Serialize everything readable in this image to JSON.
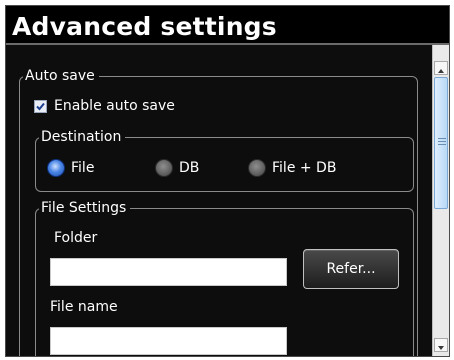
{
  "window": {
    "title": "Advanced settings"
  },
  "auto_save": {
    "legend": "Auto save",
    "enable_label": "Enable auto save",
    "enable_checked": true
  },
  "destination": {
    "legend": "Destination",
    "options": [
      "File",
      "DB",
      "File + DB"
    ],
    "selected": "File"
  },
  "file_settings": {
    "legend": "File Settings",
    "folder_label": "Folder",
    "folder_value": "",
    "refer_button": "Refer...",
    "file_name_label": "File name",
    "file_name_value": ""
  },
  "icons": {
    "scroll_up": "up-arrow-icon",
    "scroll_down": "down-arrow-icon",
    "checkmark": "check-icon"
  },
  "colors": {
    "background": "#0d0d0d",
    "text": "#ffffff",
    "radio_selected": "#4b86e6"
  }
}
